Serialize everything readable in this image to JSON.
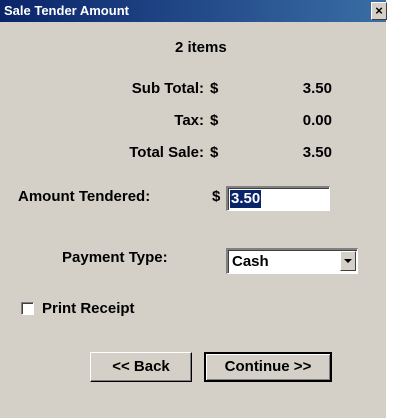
{
  "window": {
    "title": "Sale Tender Amount",
    "close_glyph": "×"
  },
  "summary": {
    "items_count": "2 items",
    "sub_total_label": "Sub Total:",
    "sub_total_currency": "$",
    "sub_total_value": "3.50",
    "tax_label": "Tax:",
    "tax_currency": "$",
    "tax_value": "0.00",
    "total_label": "Total Sale:",
    "total_currency": "$",
    "total_value": "3.50"
  },
  "tender": {
    "label": "Amount Tendered:",
    "currency": "$",
    "value": "3.50"
  },
  "payment": {
    "label": "Payment Type:",
    "selected": "Cash"
  },
  "print_receipt": {
    "label": "Print Receipt",
    "checked": false
  },
  "buttons": {
    "back_label": "<< Back",
    "continue_label": "Continue >>"
  },
  "colors": {
    "title_bar": "#0a246a",
    "dialog_bg": "#d4d0c8",
    "selection": "#0a246a"
  }
}
